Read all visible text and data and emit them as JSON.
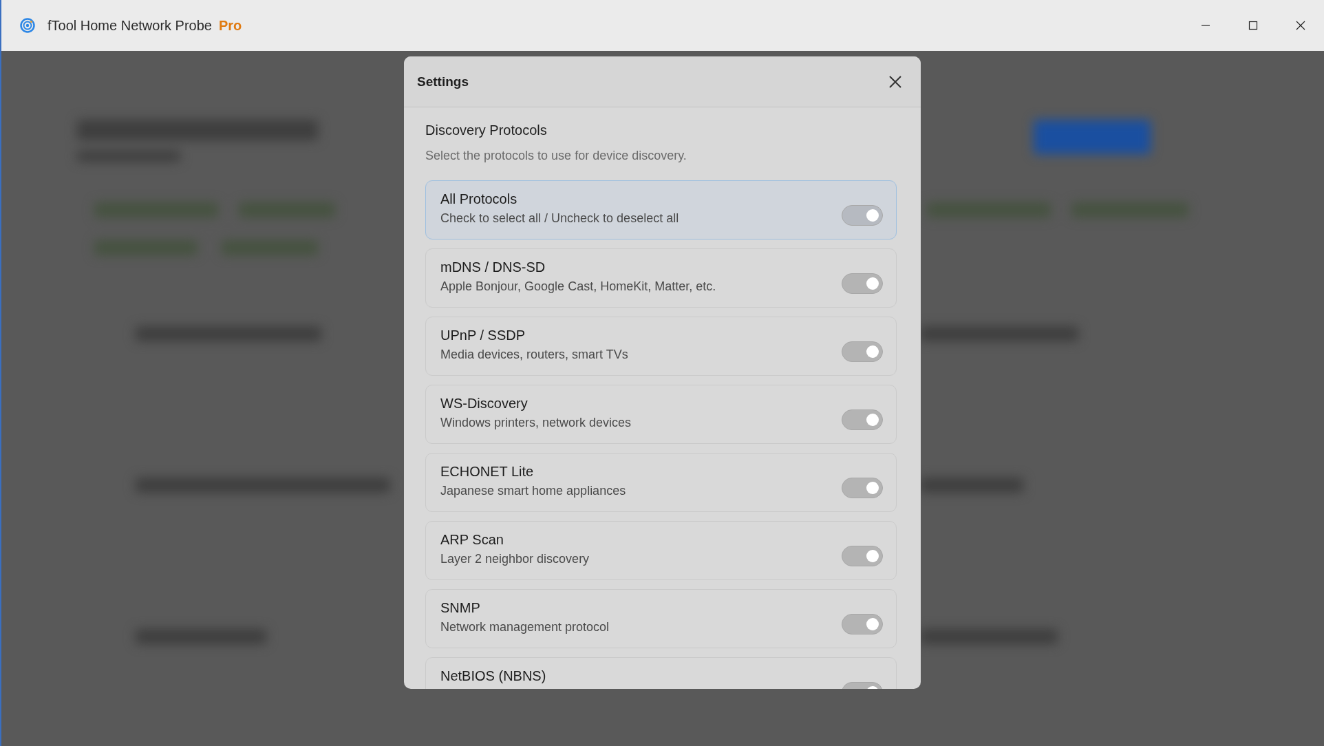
{
  "window": {
    "title": "fTool Home Network Probe",
    "edition": "Pro"
  },
  "dialog": {
    "title": "Settings",
    "section_title": "Discovery Protocols",
    "section_hint": "Select the protocols to use for device discovery.",
    "protocols": [
      {
        "name": "All Protocols",
        "description": "Check to select all / Uncheck to deselect all",
        "on": true,
        "selected": true
      },
      {
        "name": "mDNS / DNS-SD",
        "description": "Apple Bonjour, Google Cast, HomeKit, Matter, etc.",
        "on": true,
        "selected": false
      },
      {
        "name": "UPnP / SSDP",
        "description": "Media devices, routers, smart TVs",
        "on": true,
        "selected": false
      },
      {
        "name": "WS-Discovery",
        "description": "Windows printers, network devices",
        "on": true,
        "selected": false
      },
      {
        "name": "ECHONET Lite",
        "description": "Japanese smart home appliances",
        "on": true,
        "selected": false
      },
      {
        "name": "ARP Scan",
        "description": "Layer 2 neighbor discovery",
        "on": true,
        "selected": false
      },
      {
        "name": "SNMP",
        "description": "Network management protocol",
        "on": true,
        "selected": false
      },
      {
        "name": "NetBIOS (NBNS)",
        "on": true,
        "selected": false
      }
    ]
  }
}
